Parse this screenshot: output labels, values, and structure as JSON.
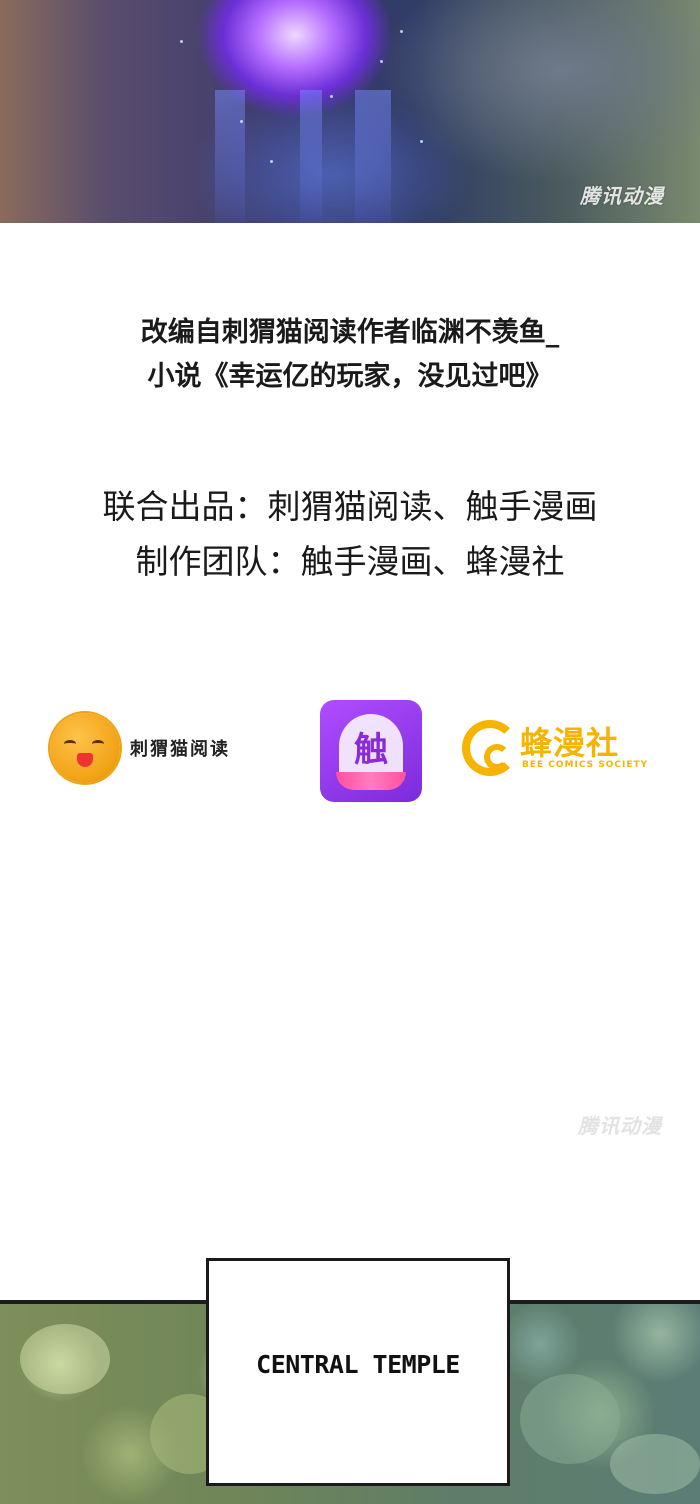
{
  "artwork": {
    "watermark_top": "腾讯动漫"
  },
  "credits": {
    "adaptation_line_1": "改编自刺猬猫阅读作者临渊不羡鱼_",
    "adaptation_line_2": "小说《幸运亿的玩家，没见过吧》",
    "production_line_1": "联合出品：刺猬猫阅读、触手漫画",
    "production_line_2": "制作团队：触手漫画、蜂漫社"
  },
  "logos": {
    "hedgehog_name": "刺猬猫阅读",
    "chushou_char": "触",
    "bee_name": "蜂漫社",
    "bee_subtitle": "BEE COMICS SOCIETY",
    "bee_color": "#f6b400",
    "chushou_color": "#9b3cf0"
  },
  "watermark_mid": "腾讯动漫",
  "caption": {
    "text": "Central Temple"
  }
}
